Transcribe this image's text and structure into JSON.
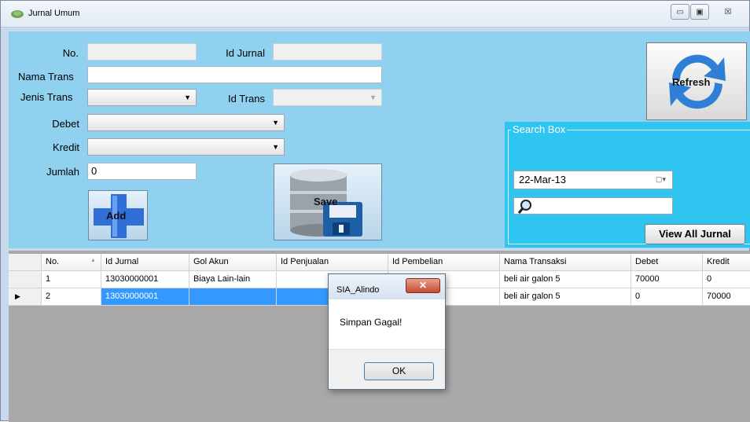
{
  "window": {
    "title": "Jurnal Umum",
    "min_glyph": "▭",
    "max_glyph": "▣",
    "close_glyph": "☒"
  },
  "form": {
    "no_label": "No.",
    "id_jurnal_label": "Id Jurnal",
    "nama_trans_label": "Nama Trans",
    "jenis_trans_label": "Jenis Trans",
    "id_trans_label": "Id Trans",
    "debet_label": "Debet",
    "kredit_label": "Kredit",
    "jumlah_label": "Jumlah",
    "jumlah_value": "0",
    "add_label": "Add",
    "save_label": "Save",
    "refresh_label": "Refresh"
  },
  "search": {
    "legend": "Search Box",
    "date_value": "22-Mar-13",
    "view_all_label": "View All Jurnal"
  },
  "grid": {
    "columns": [
      "No.",
      "Id Jurnal",
      "Gol Akun",
      "Id Penjualan",
      "Id Pembelian",
      "Nama Transaksi",
      "Debet",
      "Kredit"
    ],
    "sort_glyph": "▲",
    "row_indicator": "▶",
    "rows": [
      [
        "1",
        "13030000001",
        "Biaya Lain-lain",
        "",
        "",
        "beli air galon 5",
        "70000",
        "0"
      ],
      [
        "2",
        "13030000001",
        "",
        "",
        "",
        "beli air galon 5",
        "0",
        "70000"
      ]
    ]
  },
  "dialog": {
    "title": "SIA_Alindo",
    "close_glyph": "✕",
    "message": "Simpan Gagal!",
    "ok_label": "OK"
  },
  "colors": {
    "form_bg": "#8fd1ef",
    "search_bg": "#2ec6f0",
    "grid_bg": "#a9a9a9",
    "selection": "#3399ff"
  }
}
